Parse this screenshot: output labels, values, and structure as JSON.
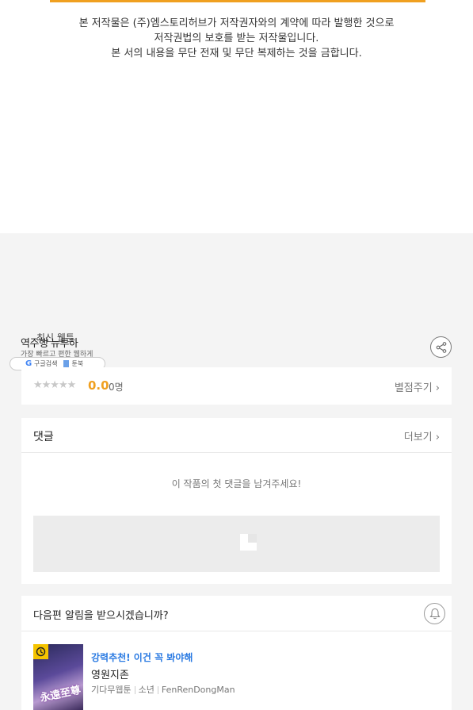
{
  "copyright": {
    "line1": "본 저작물은 (주)엠스토리허브가 저작권자와의 계약에 따라 발행한 것으로",
    "line2": "저작권법의 보호를 받는 저작물입니다.",
    "line3": "본 서의 내용을 무단 전재 및 무단 복제하는 것을 금합니다."
  },
  "overlay": {
    "title_a": "최신 웹툰",
    "title_b": "역주행 뉴투하",
    "subtitle": "가장 빠르고 편한 웹하게",
    "pill_google": "구글검색",
    "pill_brand": "툰북"
  },
  "rating": {
    "stars": "★★★★★",
    "score": "0.0",
    "count": "0명",
    "rate_link": "별점주기",
    "rate_chevron": "›"
  },
  "comments": {
    "title": "댓글",
    "more": "더보기",
    "more_chevron": "›",
    "empty_text": "이 작품의 첫 댓글을 남겨주세요!"
  },
  "notify": {
    "question": "다음편 알림을 받으시겠습니까?"
  },
  "recommendation": {
    "tag": "강력추천! 이건 꼭 봐야해",
    "title": "영원지존",
    "genre": "기다무웹툰",
    "category": "소년",
    "author": "FenRenDongMan",
    "thumb_text": "永遠至尊"
  },
  "colors": {
    "accent_orange": "#f0a020",
    "link_blue": "#2a7ae2",
    "badge_yellow": "#f5c400"
  },
  "icons": [
    "share-icon",
    "bell-icon",
    "clock-icon",
    "chevron-right-icon",
    "star-icon",
    "google-icon",
    "book-icon",
    "placeholder-icon"
  ]
}
